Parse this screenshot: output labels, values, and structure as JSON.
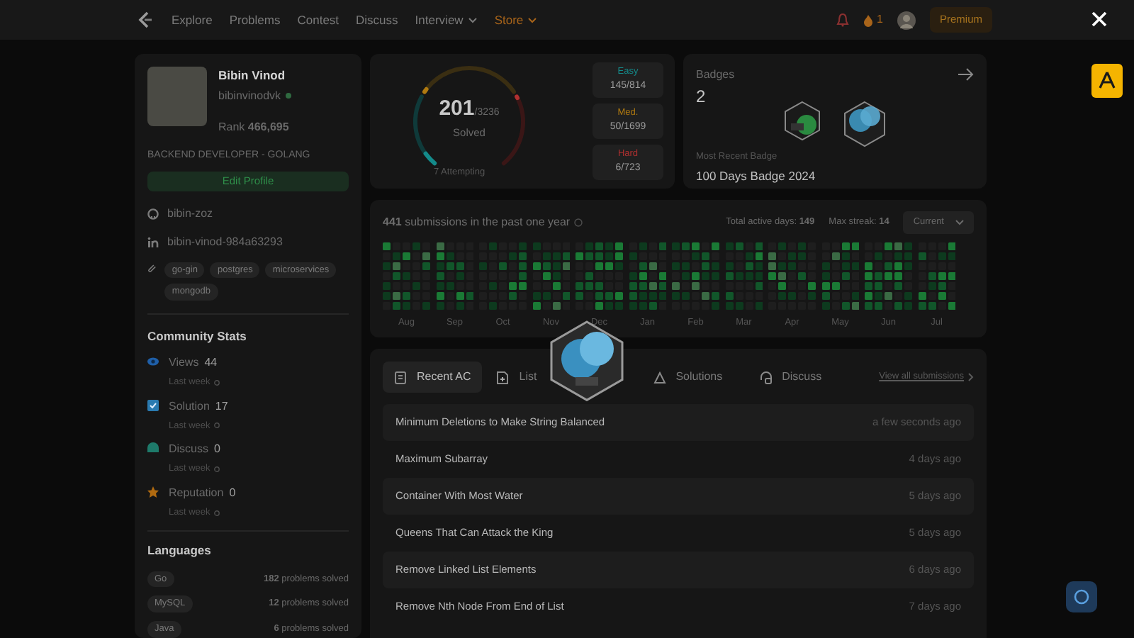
{
  "nav": {
    "links": [
      {
        "label": "Explore",
        "dropdown": false,
        "highlight": false
      },
      {
        "label": "Problems",
        "dropdown": false,
        "highlight": false
      },
      {
        "label": "Contest",
        "dropdown": false,
        "highlight": false
      },
      {
        "label": "Discuss",
        "dropdown": false,
        "highlight": false
      },
      {
        "label": "Interview",
        "dropdown": true,
        "highlight": false
      },
      {
        "label": "Store",
        "dropdown": true,
        "highlight": true
      }
    ],
    "streak_count": "1",
    "premium_button": "Premium"
  },
  "profile": {
    "name": "Bibin Vinod",
    "username": "bibinvinodvk",
    "rank": "Rank **466,695**",
    "headline": "BACKEND DEVELOPER - GOLANG",
    "edit_button": "Edit Profile",
    "links": [
      {
        "kind": "github",
        "text": "bibin-zoz"
      },
      {
        "kind": "linkedin",
        "text": "bibin-vinod-984a63293"
      }
    ],
    "skills": [
      "go-gin",
      "postgres",
      "microservices",
      "mongodb"
    ]
  },
  "community_stats": {
    "title": "Community Stats",
    "items": [
      {
        "kind": "views",
        "label": "Views",
        "value": "44",
        "note": "Last week"
      },
      {
        "kind": "solution",
        "label": "Solution",
        "value": "17",
        "note": "Last week"
      },
      {
        "kind": "discuss",
        "label": "Discuss",
        "value": "0",
        "note": "Last week"
      },
      {
        "kind": "reputation",
        "label": "Reputation",
        "value": "0",
        "note": "Last week"
      }
    ]
  },
  "languages": {
    "title": "Languages",
    "items": [
      {
        "name": "Go",
        "count": "**182** problems solved"
      },
      {
        "name": "MySQL",
        "count": "**12** problems solved"
      },
      {
        "name": "Java",
        "count": "**6** problems solved"
      }
    ]
  },
  "solved": {
    "count": "201",
    "total": "/3236",
    "label": "Solved",
    "attempting": "7 Attempting",
    "difficulties": [
      {
        "kind": "easy",
        "label": "Easy",
        "value": "145/814"
      },
      {
        "kind": "medium",
        "label": "Med.",
        "value": "50/1699"
      },
      {
        "kind": "hard",
        "label": "Hard",
        "value": "6/723"
      }
    ]
  },
  "badges": {
    "title": "Badges",
    "count": "2",
    "recent_label": "Most Recent Badge",
    "recent_name": "100 Days Badge 2024"
  },
  "activity": {
    "summary": "**441** submissions in the past one year",
    "active_days": "Total active days: **149**",
    "max_streak": "Max streak: **14**",
    "period": "Current",
    "months": [
      "Aug",
      "Sep",
      "Oct",
      "Nov",
      "Dec",
      "Jan",
      "Feb",
      "Mar",
      "Apr",
      "May",
      "Jun",
      "Jul"
    ]
  },
  "submissions": {
    "tabs": [
      {
        "label": "Recent AC",
        "kind": "recent",
        "selected": true
      },
      {
        "label": "List",
        "kind": "list",
        "selected": false
      },
      {
        "label": "Solutions",
        "kind": "solutions",
        "selected": false
      },
      {
        "label": "Discuss",
        "kind": "discuss",
        "selected": false
      }
    ],
    "view_all": "View all submissions",
    "rows": [
      {
        "title": "Minimum Deletions to Make String Balanced",
        "time": "a few seconds ago"
      },
      {
        "title": "Maximum Subarray",
        "time": "4 days ago"
      },
      {
        "title": "Container With Most Water",
        "time": "5 days ago"
      },
      {
        "title": "Queens That Can Attack the King",
        "time": "5 days ago"
      },
      {
        "title": "Remove Linked List Elements",
        "time": "6 days ago"
      },
      {
        "title": "Remove Nth Node From End of List",
        "time": "7 days ago"
      }
    ]
  }
}
